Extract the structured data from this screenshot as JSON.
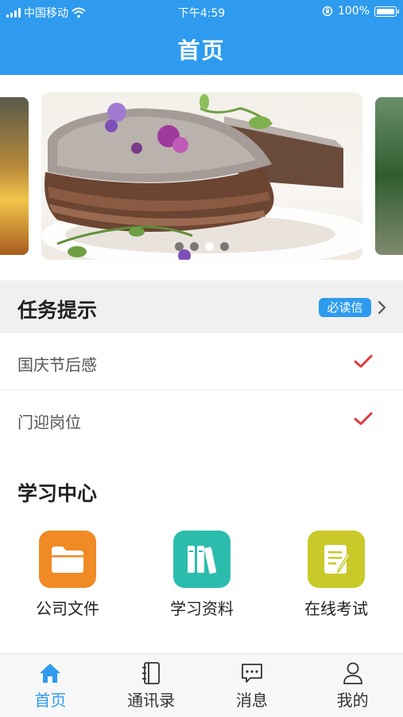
{
  "status": {
    "carrier": "中国移动",
    "time": "下午4:59",
    "battery": "100%"
  },
  "nav": {
    "title": "首页"
  },
  "carousel": {
    "slides": [
      "sunset-landscape",
      "chocolate-cake",
      "forest-landscape"
    ],
    "active_index": 2,
    "dot_count": 4
  },
  "tasks": {
    "title": "任务提示",
    "badge": "必读信",
    "items": [
      {
        "label": "国庆节后感",
        "done": true
      },
      {
        "label": "门迎岗位",
        "done": true
      }
    ]
  },
  "learning": {
    "title": "学习中心",
    "items": [
      {
        "label": "公司文件",
        "icon": "folder-icon",
        "color": "#f08a24"
      },
      {
        "label": "学习资料",
        "icon": "books-icon",
        "color": "#2bbcae"
      },
      {
        "label": "在线考试",
        "icon": "exam-icon",
        "color": "#c9c92a"
      }
    ]
  },
  "tabbar": {
    "items": [
      {
        "label": "首页",
        "icon": "home-icon",
        "active": true
      },
      {
        "label": "通讯录",
        "icon": "contacts-icon",
        "active": false
      },
      {
        "label": "消息",
        "icon": "message-icon",
        "active": false
      },
      {
        "label": "我的",
        "icon": "user-icon",
        "active": false
      }
    ]
  },
  "colors": {
    "primary": "#2e9bee",
    "check": "#e0393e"
  }
}
